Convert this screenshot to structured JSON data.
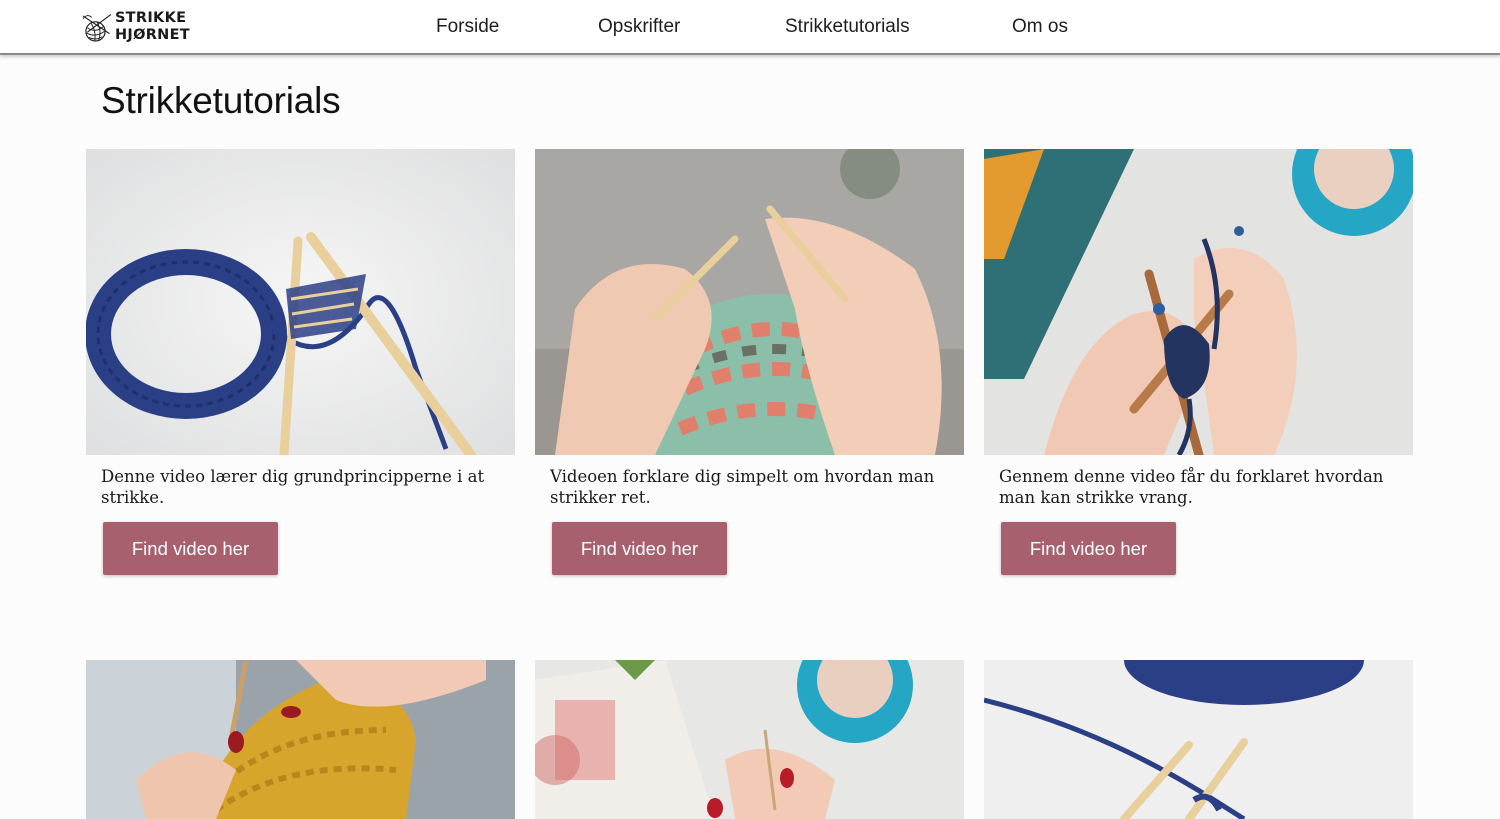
{
  "brand": {
    "line1": "STRIKKE",
    "line2": "HJØRNET"
  },
  "nav": {
    "home": "Forside",
    "recipes": "Opskrifter",
    "tutorials": "Strikketutorials",
    "about": "Om os"
  },
  "page_title": "Strikketutorials",
  "cards": [
    {
      "description": "Denne video lærer dig grundprincipperne i at strikke.",
      "button": "Find video her"
    },
    {
      "description": "Videoen forklare dig simpelt om hvordan man strikker ret.",
      "button": "Find video her"
    },
    {
      "description": "Gennem denne video får du forklaret hvordan man kan strikke vrang.",
      "button": "Find video her"
    }
  ],
  "colors": {
    "button": "#a8606e",
    "nav_border": "#8a8a8a",
    "accent_yarn_blue": "#2b3f86"
  }
}
